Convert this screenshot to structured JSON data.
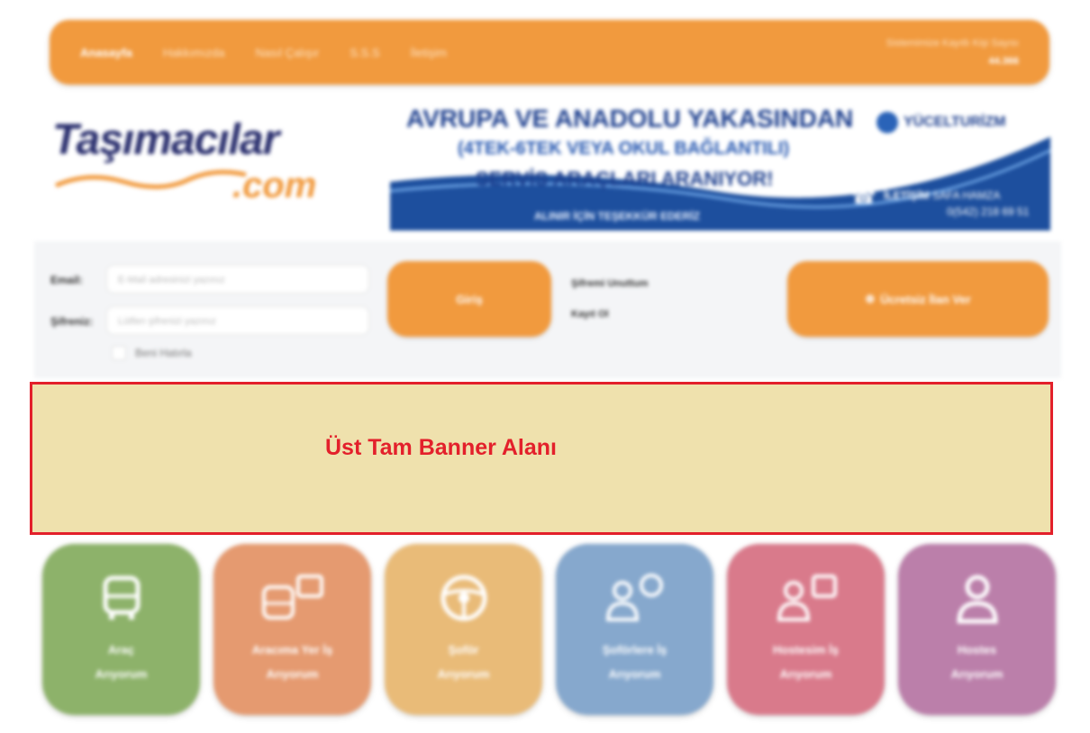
{
  "nav": {
    "items": [
      {
        "label": "Anasayfa",
        "active": true
      },
      {
        "label": "Hakkımızda",
        "active": false
      },
      {
        "label": "Nasıl Çalışır",
        "active": false
      },
      {
        "label": "S.S.S",
        "active": false
      },
      {
        "label": "İletişim",
        "active": false
      }
    ],
    "right_line1": "Sistemimize Kayıtlı Kişi Sayısı",
    "right_line2": "44.366"
  },
  "logo": {
    "main": "Taşımacılar",
    "sub": ".com"
  },
  "ad": {
    "line1": "AVRUPA VE ANADOLU YAKASINDAN",
    "line2": "(4TEK-6TEK VEYA OKUL BAĞLANTILI)",
    "line3": "SERVİS ARAÇLARI ARANIYOR!",
    "line4": "ALINIR İÇİN TEŞEKKÜR EDERİZ",
    "brand": "YÜCELTURİZM",
    "phone_label": "İLETİŞİM",
    "phone_name": "SAFA HAMZA",
    "phone_number": "0(542) 218 69 51"
  },
  "login": {
    "user_label": "Email:",
    "user_placeholder": "E-Mail adresinizi yazınız",
    "pass_label": "Şifreniz:",
    "pass_placeholder": "Lütfen şifrenizi yazınız",
    "remember_label": "Beni Hatırla",
    "login_button": "Giriş",
    "forgot_link": "Şifremi Unuttum",
    "register_link": "Kayıt Ol",
    "post_button": "Ücretsiz İlan Ver"
  },
  "banner_area": {
    "label": "Üst Tam Banner Alanı"
  },
  "tiles": [
    {
      "label": "Araç\nArıyorum",
      "color": "#8db26a",
      "icon": "bus-icon"
    },
    {
      "label": "Aracıma Yer İş\nArıyorum",
      "color": "#e59a70",
      "icon": "bus-suitcase-icon"
    },
    {
      "label": "Şoför\nArıyorum",
      "color": "#e9bb78",
      "icon": "steering-wheel-icon"
    },
    {
      "label": "Şoförlere İş\nArıyorum",
      "color": "#86a8cd",
      "icon": "driver-wheel-icon"
    },
    {
      "label": "Hostesim İş\nArıyorum",
      "color": "#d97a8b",
      "icon": "hostess-suitcase-icon"
    },
    {
      "label": "Hostes\nArıyorum",
      "color": "#bb7faa",
      "icon": "person-icon"
    }
  ]
}
